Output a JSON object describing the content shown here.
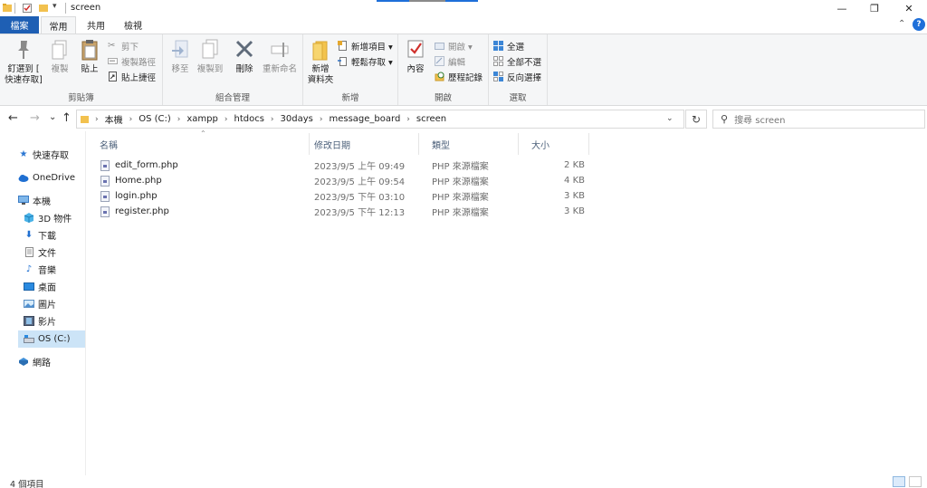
{
  "window": {
    "title": "screen",
    "minimize": "—",
    "restore": "❐",
    "close": "✕"
  },
  "ribbon_tabs": [
    "檔案",
    "常用",
    "共用",
    "檢視"
  ],
  "help": "?",
  "ribbon": {
    "clipboard": {
      "label": "剪貼簿",
      "pin": "釘選到 [\n快速存取]",
      "copy": "複製",
      "paste": "貼上",
      "cut": "剪下",
      "copy_path": "複製路徑",
      "paste_shortcut": "貼上捷徑"
    },
    "organize": {
      "label": "組合管理",
      "move_to": "移至",
      "copy_to": "複製到",
      "delete": "刪除",
      "rename": "重新命名"
    },
    "new": {
      "label": "新增",
      "new_folder": "新增\n資料夾",
      "new_item": "新增項目 ▾",
      "easy_access": "輕鬆存取 ▾"
    },
    "open": {
      "label": "開啟",
      "properties": "內容",
      "open": "開啟 ▾",
      "edit": "編輯",
      "history": "歷程記錄"
    },
    "select": {
      "label": "選取",
      "select_all": "全選",
      "select_none": "全部不選",
      "invert": "反向選擇"
    }
  },
  "address": {
    "back": "←",
    "forward": "→",
    "recent": "⌄",
    "up": "↑",
    "path": [
      "本機",
      "OS (C:)",
      "xampp",
      "htdocs",
      "30days",
      "message_board",
      "screen"
    ],
    "dropdown": "⌄",
    "refresh": "↻",
    "search_placeholder": "搜尋 screen",
    "search_icon": "search-icon"
  },
  "nav": {
    "quick_access": "快速存取",
    "onedrive": "OneDrive",
    "this_pc": "本機",
    "objects3d": "3D 物件",
    "downloads": "下載",
    "documents": "文件",
    "music": "音樂",
    "desktop": "桌面",
    "pictures": "圖片",
    "videos": "影片",
    "os_c": "OS (C:)",
    "network": "網路"
  },
  "columns": {
    "name": "名稱",
    "modified": "修改日期",
    "type": "類型",
    "size": "大小"
  },
  "files": [
    {
      "name": "edit_form.php",
      "modified": "2023/9/5 上午 09:49",
      "type": "PHP 來源檔案",
      "size": "2 KB"
    },
    {
      "name": "Home.php",
      "modified": "2023/9/5 上午 09:54",
      "type": "PHP 來源檔案",
      "size": "4 KB"
    },
    {
      "name": "login.php",
      "modified": "2023/9/5 下午 03:10",
      "type": "PHP 來源檔案",
      "size": "3 KB"
    },
    {
      "name": "register.php",
      "modified": "2023/9/5 下午 12:13",
      "type": "PHP 來源檔案",
      "size": "3 KB"
    }
  ],
  "status": {
    "item_count": "4 個項目"
  },
  "colors": {
    "file_tab": "#1e5fb4",
    "selection": "#cce4f7",
    "header_text": "#4c607a"
  }
}
